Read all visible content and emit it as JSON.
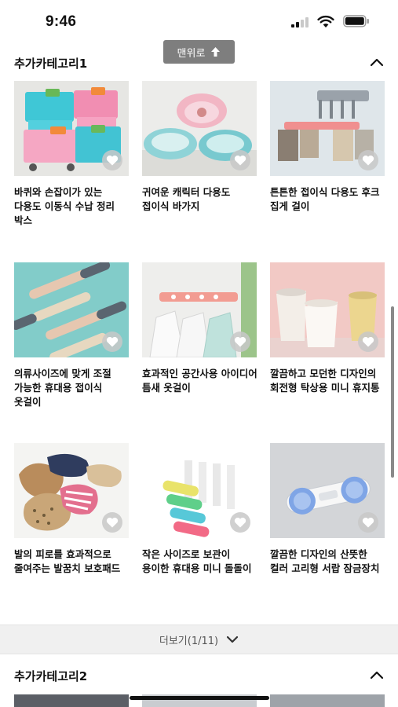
{
  "status_bar": {
    "time": "9:46"
  },
  "back_to_top": {
    "label": "맨위로"
  },
  "sections": [
    {
      "title": "추가카테고리1"
    },
    {
      "title": "추가카테고리2"
    }
  ],
  "products": [
    {
      "name": "바퀴와 손잡이가 있는 다용도 이동식 수납 정리 박스",
      "image": "colorful-storage-boxes"
    },
    {
      "name": "귀여운 캐릭터 다용도 접이식 바가지",
      "image": "folding-basins"
    },
    {
      "name": "튼튼한 접이식 다용도 후크 집게 걸이",
      "image": "hook-clip-hanger"
    },
    {
      "name": "의류사이즈에 맞게 조절 가능한 휴대용 접이식 옷걸이",
      "image": "folding-hangers"
    },
    {
      "name": "효과적인 공간사용 아이디어 틈새 옷걸이",
      "image": "gap-hanger"
    },
    {
      "name": "깔끔하고 모던한 디자인의 회전형 탁상용 미니 휴지통",
      "image": "mini-trash-bins"
    },
    {
      "name": "발의 피로를 효과적으로 줄여주는 발꿈치 보호패드",
      "image": "heel-pads"
    },
    {
      "name": "작은 사이즈로 보관이 용이한 휴대용 미니 돌돌이",
      "image": "mini-lint-rollers"
    },
    {
      "name": "깔끔한 디자인의 산뜻한 컬러 고리형 서랍 잠금장치",
      "image": "drawer-lock"
    }
  ],
  "more_button": {
    "label": "더보기(1/11)"
  },
  "icons": {
    "wishlist": "heart-icon",
    "back_to_top": "arrow-up-icon",
    "collapse": "chevron-up-icon",
    "more": "chevron-down-icon"
  },
  "colors": {
    "back_to_top_bg": "#7e7e7e",
    "more_bar_bg": "#f0f0f0",
    "text": "#111111"
  }
}
